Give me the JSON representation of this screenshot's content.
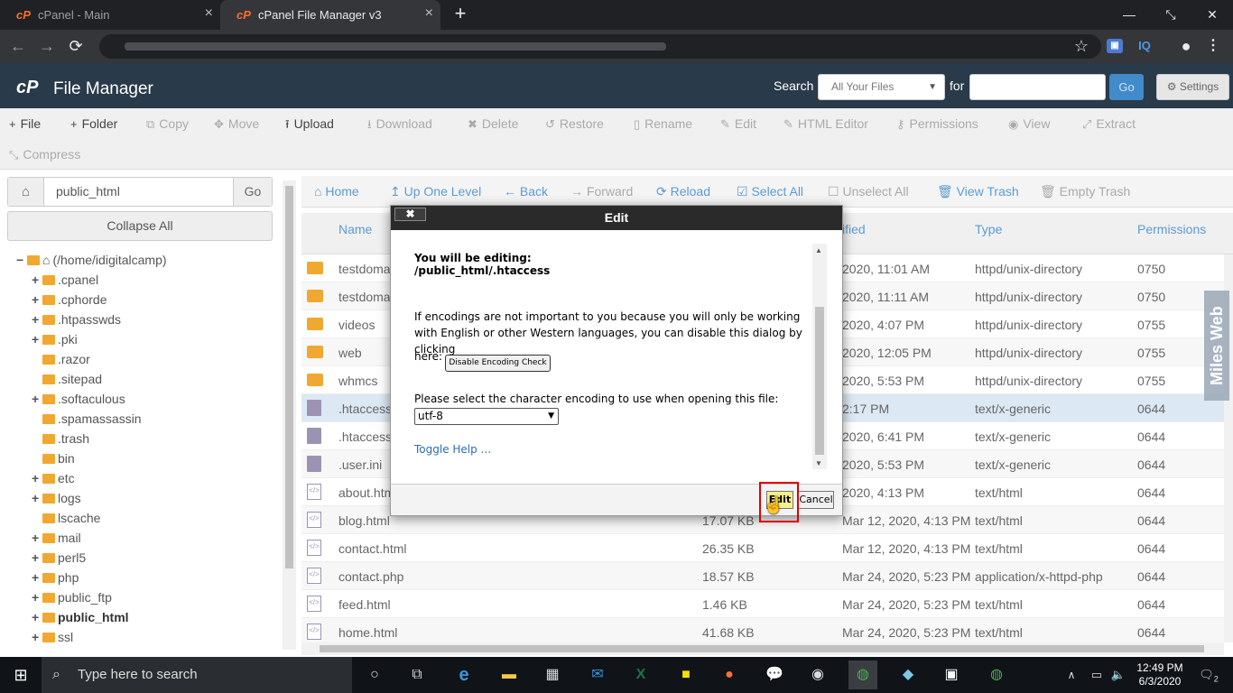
{
  "browser": {
    "tabs": [
      {
        "title": "cPanel - Main",
        "active": false
      },
      {
        "title": "cPanel File Manager v3",
        "active": true
      }
    ],
    "new_tab": "+",
    "extensions": [
      "IQ"
    ]
  },
  "header": {
    "logo": "cP",
    "title": "File Manager",
    "search_label": "Search",
    "search_scope": "All Your Files",
    "for_label": "for",
    "go_label": "Go",
    "settings_label": "Settings"
  },
  "actions": [
    {
      "label": "File",
      "icon": "+",
      "enabled": true
    },
    {
      "label": "Folder",
      "icon": "+",
      "enabled": true
    },
    {
      "label": "Copy",
      "icon": "⧉",
      "enabled": false
    },
    {
      "label": "Move",
      "icon": "✥",
      "enabled": false
    },
    {
      "label": "Upload",
      "icon": "⭱",
      "enabled": true
    },
    {
      "label": "Download",
      "icon": "⭳",
      "enabled": false
    },
    {
      "label": "Delete",
      "icon": "✖",
      "enabled": false
    },
    {
      "label": "Restore",
      "icon": "↺",
      "enabled": false
    },
    {
      "label": "Rename",
      "icon": "▯",
      "enabled": false
    },
    {
      "label": "Edit",
      "icon": "✎",
      "enabled": false
    },
    {
      "label": "HTML Editor",
      "icon": "✎",
      "enabled": false
    },
    {
      "label": "Permissions",
      "icon": "⚷",
      "enabled": false
    },
    {
      "label": "View",
      "icon": "◉",
      "enabled": false
    },
    {
      "label": "Extract",
      "icon": "⤢",
      "enabled": false
    },
    {
      "label": "Compress",
      "icon": "⤡",
      "enabled": false
    }
  ],
  "left": {
    "path_value": "public_html",
    "go_label": "Go",
    "collapse_label": "Collapse All",
    "tree": [
      {
        "label": "(/home/idigitalcamp)",
        "level": 0,
        "pm": "−",
        "home": true
      },
      {
        "label": ".cpanel",
        "level": 1,
        "pm": "+"
      },
      {
        "label": ".cphorde",
        "level": 1,
        "pm": "+"
      },
      {
        "label": ".htpasswds",
        "level": 1,
        "pm": "+"
      },
      {
        "label": ".pki",
        "level": 1,
        "pm": "+"
      },
      {
        "label": ".razor",
        "level": 1,
        "pm": ""
      },
      {
        "label": ".sitepad",
        "level": 1,
        "pm": ""
      },
      {
        "label": ".softaculous",
        "level": 1,
        "pm": "+"
      },
      {
        "label": ".spamassassin",
        "level": 1,
        "pm": ""
      },
      {
        "label": ".trash",
        "level": 1,
        "pm": ""
      },
      {
        "label": "bin",
        "level": 1,
        "pm": ""
      },
      {
        "label": "etc",
        "level": 1,
        "pm": "+"
      },
      {
        "label": "logs",
        "level": 1,
        "pm": "+"
      },
      {
        "label": "lscache",
        "level": 1,
        "pm": ""
      },
      {
        "label": "mail",
        "level": 1,
        "pm": "+"
      },
      {
        "label": "perl5",
        "level": 1,
        "pm": "+"
      },
      {
        "label": "php",
        "level": 1,
        "pm": "+"
      },
      {
        "label": "public_ftp",
        "level": 1,
        "pm": "+"
      },
      {
        "label": "public_html",
        "level": 1,
        "pm": "+",
        "bold": true
      },
      {
        "label": "ssl",
        "level": 1,
        "pm": "+"
      }
    ]
  },
  "nav": [
    {
      "label": "Home",
      "icon": "⌂",
      "enabled": true
    },
    {
      "label": "Up One Level",
      "icon": "↥",
      "enabled": true
    },
    {
      "label": "Back",
      "icon": "←",
      "enabled": true
    },
    {
      "label": "Forward",
      "icon": "→",
      "enabled": false
    },
    {
      "label": "Reload",
      "icon": "⟳",
      "enabled": true
    },
    {
      "label": "Select All",
      "icon": "☑",
      "enabled": true
    },
    {
      "label": "Unselect All",
      "icon": "☐",
      "enabled": false
    },
    {
      "label": "View Trash",
      "icon": "🗑",
      "enabled": true
    },
    {
      "label": "Empty Trash",
      "icon": "🗑",
      "enabled": false
    }
  ],
  "table": {
    "headers": {
      "name": "Name",
      "modified": "ified",
      "type": "Type",
      "permissions": "Permissions"
    },
    "rows": [
      {
        "icon": "dir",
        "name": "testdoma",
        "size": "",
        "modified": "2020, 11:01 AM",
        "type": "httpd/unix-directory",
        "perm": "0750"
      },
      {
        "icon": "dir",
        "name": "testdoma",
        "size": "",
        "modified": "2020, 11:11 AM",
        "type": "httpd/unix-directory",
        "perm": "0750"
      },
      {
        "icon": "dir",
        "name": "videos",
        "size": "",
        "modified": "2020, 4:07 PM",
        "type": "httpd/unix-directory",
        "perm": "0755"
      },
      {
        "icon": "dir",
        "name": "web",
        "size": "",
        "modified": "2020, 12:05 PM",
        "type": "httpd/unix-directory",
        "perm": "0755"
      },
      {
        "icon": "dir",
        "name": "whmcs",
        "size": "",
        "modified": "2020, 5:53 PM",
        "type": "httpd/unix-directory",
        "perm": "0755"
      },
      {
        "icon": "doc",
        "name": ".htaccess",
        "size": "",
        "modified": "2:17 PM",
        "type": "text/x-generic",
        "perm": "0644",
        "selected": true
      },
      {
        "icon": "doc",
        "name": ".htaccess",
        "size": "",
        "modified": "2020, 6:41 PM",
        "type": "text/x-generic",
        "perm": "0644"
      },
      {
        "icon": "doc",
        "name": ".user.ini",
        "size": "",
        "modified": "2020, 5:53 PM",
        "type": "text/x-generic",
        "perm": "0644"
      },
      {
        "icon": "html",
        "name": "about.htm",
        "size": "",
        "modified": "2020, 4:13 PM",
        "type": "text/html",
        "perm": "0644"
      },
      {
        "icon": "html",
        "name": "blog.html",
        "size": "17.07 KB",
        "modified": "Mar 12, 2020, 4:13 PM",
        "type": "text/html",
        "perm": "0644"
      },
      {
        "icon": "html",
        "name": "contact.html",
        "size": "26.35 KB",
        "modified": "Mar 12, 2020, 4:13 PM",
        "type": "text/html",
        "perm": "0644"
      },
      {
        "icon": "html",
        "name": "contact.php",
        "size": "18.57 KB",
        "modified": "Mar 24, 2020, 5:23 PM",
        "type": "application/x-httpd-php",
        "perm": "0644"
      },
      {
        "icon": "html",
        "name": "feed.html",
        "size": "1.46 KB",
        "modified": "Mar 24, 2020, 5:23 PM",
        "type": "text/html",
        "perm": "0644"
      },
      {
        "icon": "html",
        "name": "home.html",
        "size": "41.68 KB",
        "modified": "Mar 24, 2020, 5:23 PM",
        "type": "text/html",
        "perm": "0644"
      }
    ]
  },
  "dialog": {
    "title": "Edit",
    "close_label": "✖",
    "editing_label": "You will be editing:",
    "editing_path": "/public_html/.htaccess",
    "info_text": "If encodings are not important to you because you will only be working with English or other Western languages, you can disable this dialog by clicking",
    "here_label": "here:",
    "disable_label": "Disable Encoding Check",
    "select_label": "Please select the character encoding to use when opening this file:",
    "encoding_value": "utf-8",
    "toggle_help": "Toggle Help ...",
    "edit_label": "Edit",
    "cancel_label": "Cancel"
  },
  "watermark": "Miles Web",
  "taskbar": {
    "search_placeholder": "Type here to search",
    "time": "12:49 PM",
    "date": "6/3/2020",
    "notification_count": "2"
  }
}
